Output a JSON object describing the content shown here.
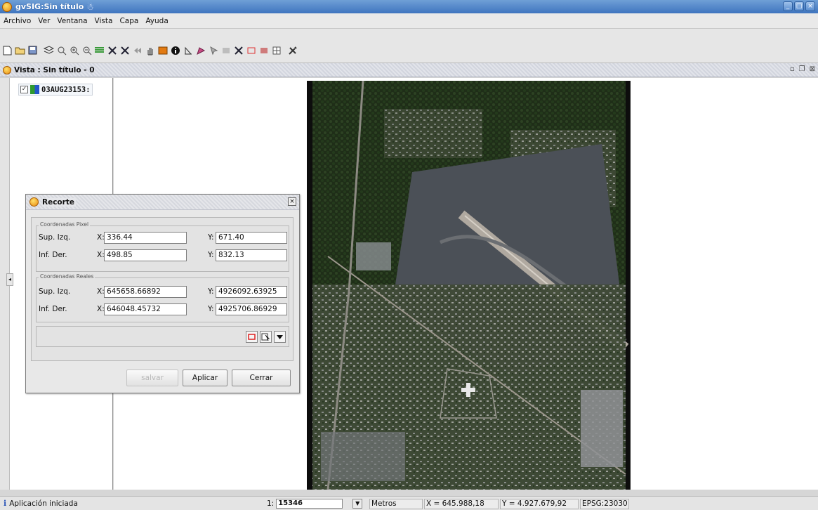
{
  "window": {
    "title": "gvSIG:Sin título",
    "title_deco": "☃"
  },
  "menubar": {
    "items": [
      "Archivo",
      "Ver",
      "Ventana",
      "Vista",
      "Capa",
      "Ayuda"
    ]
  },
  "view": {
    "title": "Vista : Sin título - 0"
  },
  "toc": {
    "layer_name": "03AUG23153:",
    "layer_checked": true
  },
  "dialog": {
    "title": "Recorte",
    "pixel_group": "Coordenadas Pixel",
    "real_group": "Coordenadas Reales",
    "sup_label": "Sup. Izq.",
    "inf_label": "Inf. Der.",
    "x_label": "X:",
    "y_label": "Y:",
    "pixel": {
      "sup_x": "336.44",
      "sup_y": "671.40",
      "inf_x": "498.85",
      "inf_y": "832.13"
    },
    "real": {
      "sup_x": "645658.66892",
      "sup_y": "4926092.63925",
      "inf_x": "646048.45732",
      "inf_y": "4925706.86929"
    },
    "buttons": {
      "salvar": "salvar",
      "aplicar": "Aplicar",
      "cerrar": "Cerrar"
    }
  },
  "status": {
    "message": "Aplicación iniciada",
    "scale_prefix": "1:",
    "scale_value": "15346",
    "units": "Metros",
    "x_coord": "X = 645.988,18",
    "y_coord": "Y = 4.927.679,92",
    "epsg": "EPSG:23030"
  }
}
